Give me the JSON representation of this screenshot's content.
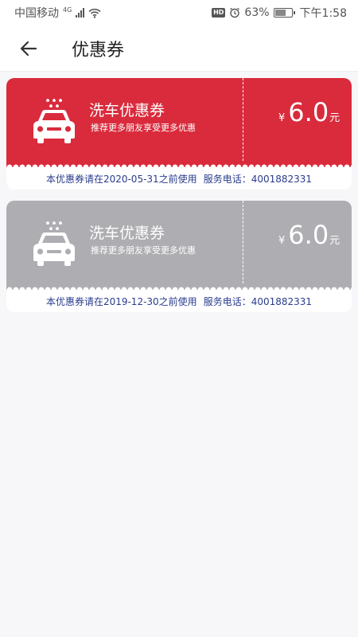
{
  "status_bar": {
    "carrier": "中国移动",
    "network": "4G",
    "battery": "63%",
    "battery_level": 0.63,
    "time": "下午1:58",
    "hd": "HD"
  },
  "header": {
    "back_icon": "arrow-left-icon",
    "title": "优惠券"
  },
  "coupons": [
    {
      "icon": "car-wash-icon",
      "title": "洗车优惠券",
      "subtitle": "推荐更多朋友享受更多优惠",
      "currency": "¥",
      "amount": "6.0",
      "unit": "元",
      "valid_text": "本优惠券请在2020-05-31之前使用",
      "service_phone": "服务电话：4001882331",
      "color": "#d92b3c"
    },
    {
      "icon": "car-wash-icon",
      "title": "洗车优惠券",
      "subtitle": "推荐更多朋友享受更多优惠",
      "currency": "¥",
      "amount": "6.0",
      "unit": "元",
      "valid_text": "本优惠券请在2019-12-30之前使用",
      "service_phone": "服务电话：4001882331",
      "color": "#aeadb1"
    }
  ]
}
